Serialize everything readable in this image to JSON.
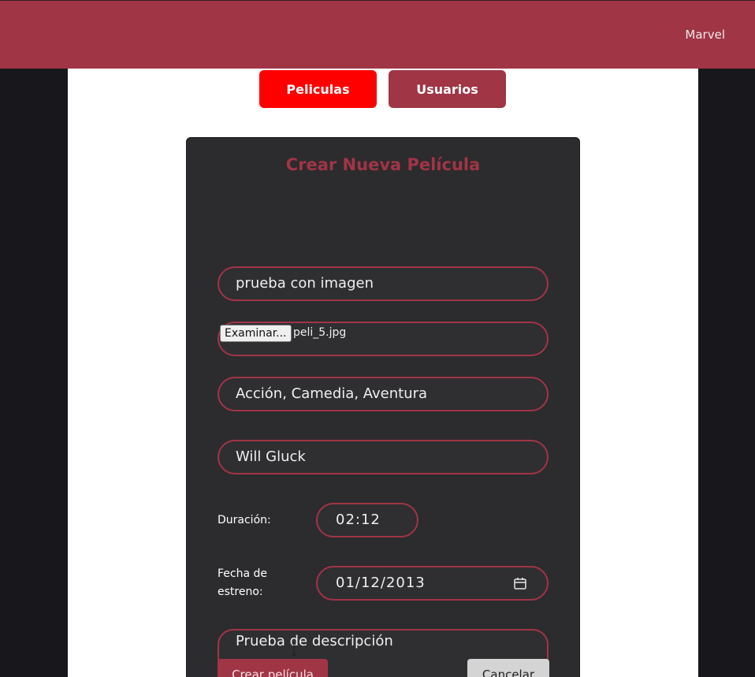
{
  "header": {
    "brand": "Marvel"
  },
  "nav": {
    "peliculas": "Peliculas",
    "usuarios": "Usuarios"
  },
  "form": {
    "title": "Crear Nueva Película",
    "title_value": "prueba con imagen",
    "file_button": "Examinar...",
    "file_name": "peli_5.jpg",
    "genres": "Acción, Camedia, Aventura",
    "director": "Will Gluck",
    "duration_label": "Duración:",
    "duration": "02:12",
    "release_label_line1": "Fecha de",
    "release_label_line2": "estreno:",
    "release_date": "01/12/2013",
    "description": "Prueba de descripción",
    "create_button": "Crear película",
    "cancel_button": "Cancelar"
  },
  "colors": {
    "accent": "#a03546",
    "active_nav": "#fe0000",
    "card_bg": "#2c2b2e",
    "page_bg": "#18171b"
  },
  "icons": [
    "calendar-icon",
    "resize-grip-icon",
    "text-cursor-icon"
  ]
}
